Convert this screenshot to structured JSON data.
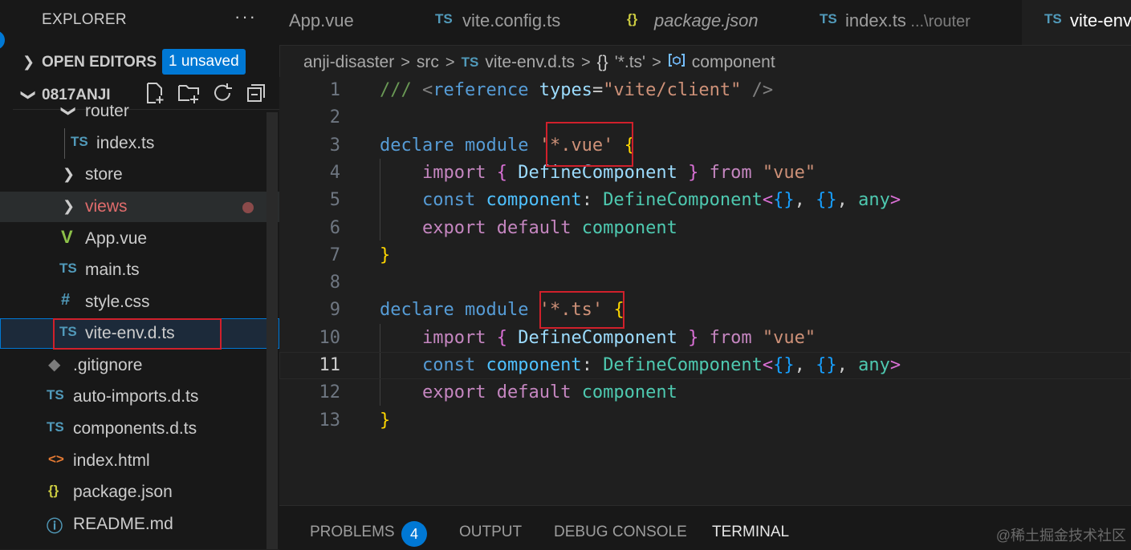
{
  "sidebar": {
    "title": "EXPLORER",
    "more": "···",
    "open_editors": {
      "label": "OPEN EDITORS",
      "badge": "1 unsaved"
    },
    "project": {
      "label": "0817ANJI"
    },
    "tree": [
      {
        "name": "router",
        "kind": "folder",
        "expanded": true
      },
      {
        "name": "index.ts",
        "kind": "ts",
        "icon_text": "TS"
      },
      {
        "name": "store",
        "kind": "folder",
        "expanded": false
      },
      {
        "name": "views",
        "kind": "folder",
        "expanded": false,
        "modified": true
      },
      {
        "name": "App.vue",
        "kind": "vue",
        "icon_text": "V"
      },
      {
        "name": "main.ts",
        "kind": "ts",
        "icon_text": "TS"
      },
      {
        "name": "style.css",
        "kind": "css",
        "icon_text": "#"
      },
      {
        "name": "vite-env.d.ts",
        "kind": "ts",
        "icon_text": "TS",
        "selected": true
      },
      {
        "name": ".gitignore",
        "kind": "git",
        "icon_text": "◆"
      },
      {
        "name": "auto-imports.d.ts",
        "kind": "ts",
        "icon_text": "TS"
      },
      {
        "name": "components.d.ts",
        "kind": "ts",
        "icon_text": "TS"
      },
      {
        "name": "index.html",
        "kind": "html",
        "icon_text": "<>"
      },
      {
        "name": "package.json",
        "kind": "json",
        "icon_text": "{}"
      },
      {
        "name": "README.md",
        "kind": "info",
        "icon_text": "ⓘ"
      }
    ]
  },
  "tabs": [
    {
      "label": "App.vue",
      "icon_text": ""
    },
    {
      "label": "vite.config.ts",
      "icon_text": "TS"
    },
    {
      "label": "package.json",
      "icon_text": "{}",
      "italic": true
    },
    {
      "label": "index.ts",
      "icon_text": "TS",
      "sub": "...\\router"
    },
    {
      "label": "vite-env",
      "icon_text": "TS",
      "active": true
    }
  ],
  "breadcrumb": {
    "items": [
      "anji-disaster",
      "src",
      "vite-env.d.ts",
      "'*.ts'",
      "component"
    ],
    "ts_icon": "TS",
    "braces_icon": "{}",
    "sep": ">"
  },
  "editor": {
    "current_line": 11,
    "lines": [
      [
        [
          "tk-cm",
          "/// "
        ],
        [
          "tk-tag",
          "<"
        ],
        [
          "tk-kw",
          "reference"
        ],
        [
          "tk-p",
          " "
        ],
        [
          "tk-attr",
          "types"
        ],
        [
          "tk-p",
          "="
        ],
        [
          "tk-str",
          "\"vite/client\""
        ],
        [
          "tk-p",
          " "
        ],
        [
          "tk-tag",
          "/>"
        ]
      ],
      [],
      [
        [
          "tk-kw",
          "declare"
        ],
        [
          "tk-p",
          " "
        ],
        [
          "tk-kw",
          "module"
        ],
        [
          "tk-p",
          " "
        ],
        [
          "tk-str",
          "'*.vue'"
        ],
        [
          "tk-p",
          " "
        ],
        [
          "tk-b1",
          "{"
        ]
      ],
      [
        [
          "tk-p",
          "    "
        ],
        [
          "tk-ctl",
          "import"
        ],
        [
          "tk-p",
          " "
        ],
        [
          "tk-b2",
          "{"
        ],
        [
          "tk-p",
          " "
        ],
        [
          "tk-attr",
          "DefineComponent"
        ],
        [
          "tk-p",
          " "
        ],
        [
          "tk-b2",
          "}"
        ],
        [
          "tk-p",
          " "
        ],
        [
          "tk-ctl",
          "from"
        ],
        [
          "tk-p",
          " "
        ],
        [
          "tk-str",
          "\"vue\""
        ]
      ],
      [
        [
          "tk-p",
          "    "
        ],
        [
          "tk-kw",
          "const"
        ],
        [
          "tk-p",
          " "
        ],
        [
          "tk-var",
          "component"
        ],
        [
          "tk-p",
          ": "
        ],
        [
          "tk-ty",
          "DefineComponent"
        ],
        [
          "tk-b2",
          "<"
        ],
        [
          "tk-b3",
          "{}"
        ],
        [
          "tk-p",
          ", "
        ],
        [
          "tk-b3",
          "{}"
        ],
        [
          "tk-p",
          ", "
        ],
        [
          "tk-ty",
          "any"
        ],
        [
          "tk-b2",
          ">"
        ]
      ],
      [
        [
          "tk-p",
          "    "
        ],
        [
          "tk-ctl",
          "export"
        ],
        [
          "tk-p",
          " "
        ],
        [
          "tk-ctl",
          "default"
        ],
        [
          "tk-p",
          " "
        ],
        [
          "tk-ty",
          "component"
        ]
      ],
      [
        [
          "tk-b1",
          "}"
        ]
      ],
      [],
      [
        [
          "tk-kw",
          "declare"
        ],
        [
          "tk-p",
          " "
        ],
        [
          "tk-kw",
          "module"
        ],
        [
          "tk-p",
          " "
        ],
        [
          "tk-str",
          "'*.ts'"
        ],
        [
          "tk-p",
          " "
        ],
        [
          "tk-b1",
          "{"
        ]
      ],
      [
        [
          "tk-p",
          "    "
        ],
        [
          "tk-ctl",
          "import"
        ],
        [
          "tk-p",
          " "
        ],
        [
          "tk-b2",
          "{"
        ],
        [
          "tk-p",
          " "
        ],
        [
          "tk-attr",
          "DefineComponent"
        ],
        [
          "tk-p",
          " "
        ],
        [
          "tk-b2",
          "}"
        ],
        [
          "tk-p",
          " "
        ],
        [
          "tk-ctl",
          "from"
        ],
        [
          "tk-p",
          " "
        ],
        [
          "tk-str",
          "\"vue\""
        ]
      ],
      [
        [
          "tk-p",
          "    "
        ],
        [
          "tk-kw",
          "const"
        ],
        [
          "tk-p",
          " "
        ],
        [
          "tk-var",
          "component"
        ],
        [
          "tk-p",
          ": "
        ],
        [
          "tk-ty",
          "DefineComponent"
        ],
        [
          "tk-b2",
          "<"
        ],
        [
          "tk-b3",
          "{}"
        ],
        [
          "tk-p",
          ", "
        ],
        [
          "tk-b3",
          "{}"
        ],
        [
          "tk-p",
          ", "
        ],
        [
          "tk-ty",
          "any"
        ],
        [
          "tk-b2",
          ">"
        ]
      ],
      [
        [
          "tk-p",
          "    "
        ],
        [
          "tk-ctl",
          "export"
        ],
        [
          "tk-p",
          " "
        ],
        [
          "tk-ctl",
          "default"
        ],
        [
          "tk-p",
          " "
        ],
        [
          "tk-ty",
          "component"
        ]
      ],
      [
        [
          "tk-b1",
          "}"
        ]
      ]
    ]
  },
  "panel": {
    "tabs": [
      {
        "label": "PROBLEMS",
        "badge": "4"
      },
      {
        "label": "OUTPUT"
      },
      {
        "label": "DEBUG CONSOLE"
      },
      {
        "label": "TERMINAL",
        "active": true
      }
    ]
  },
  "watermark": "@稀土掘金技术社区",
  "colors": {
    "accent": "#0078d4",
    "highlight_box": "#d0202b",
    "modified": "#8a4a4a"
  }
}
